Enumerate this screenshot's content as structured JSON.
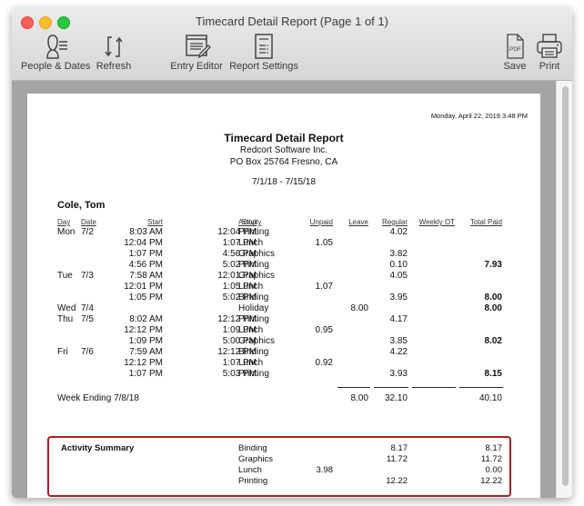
{
  "window": {
    "title": "Timecard Detail Report  (Page 1 of 1)"
  },
  "toolbar": {
    "people_dates": {
      "label": "People & Dates",
      "icon": "people-list-icon"
    },
    "refresh": {
      "label": "Refresh",
      "icon": "refresh-icon"
    },
    "entry_editor": {
      "label": "Entry Editor",
      "icon": "entry-editor-icon"
    },
    "report_settings": {
      "label": "Report Settings",
      "icon": "report-settings-icon"
    },
    "save": {
      "label": "Save",
      "icon": "pdf-icon",
      "icon_text": "PDF"
    },
    "print": {
      "label": "Print",
      "icon": "printer-icon"
    }
  },
  "report": {
    "timestamp": "Monday, April 22, 2019  3:48 PM",
    "title": "Timecard Detail Report",
    "company": "Redcort Software Inc.",
    "address": "PO Box 25764  Fresno, CA",
    "date_range": "7/1/18 - 7/15/18",
    "employee": "Cole, Tom",
    "columns": {
      "day": "Day",
      "date": "Date",
      "start": "Start",
      "stop": "Stop",
      "activity": "Activity",
      "unpaid": "Unpaid",
      "leave": "Leave",
      "regular": "Regular",
      "weekly_ot": "Weekly OT",
      "total_paid": "Total Paid"
    },
    "rows": [
      {
        "day": "Mon",
        "date": "7/2",
        "start": "8:03 AM",
        "stop": "12:04 PM",
        "activity": "Printing",
        "unpaid": "",
        "leave": "",
        "regular": "4.02",
        "weekly_ot": "",
        "total_paid": ""
      },
      {
        "day": "",
        "date": "",
        "start": "12:04 PM",
        "stop": "1:07 PM",
        "activity": "Lunch",
        "unpaid": "1.05",
        "leave": "",
        "regular": "",
        "weekly_ot": "",
        "total_paid": ""
      },
      {
        "day": "",
        "date": "",
        "start": "1:07 PM",
        "stop": "4:56 PM",
        "activity": "Graphics",
        "unpaid": "",
        "leave": "",
        "regular": "3.82",
        "weekly_ot": "",
        "total_paid": ""
      },
      {
        "day": "",
        "date": "",
        "start": "4:56 PM",
        "stop": "5:02 PM",
        "activity": "Printing",
        "unpaid": "",
        "leave": "",
        "regular": "0.10",
        "weekly_ot": "",
        "total_paid": "7.93"
      },
      {
        "day": "Tue",
        "date": "7/3",
        "start": "7:58 AM",
        "stop": "12:01 PM",
        "activity": "Graphics",
        "unpaid": "",
        "leave": "",
        "regular": "4.05",
        "weekly_ot": "",
        "total_paid": ""
      },
      {
        "day": "",
        "date": "",
        "start": "12:01 PM",
        "stop": "1:05 PM",
        "activity": "Lunch",
        "unpaid": "1.07",
        "leave": "",
        "regular": "",
        "weekly_ot": "",
        "total_paid": ""
      },
      {
        "day": "",
        "date": "",
        "start": "1:05 PM",
        "stop": "5:02 PM",
        "activity": "Binding",
        "unpaid": "",
        "leave": "",
        "regular": "3.95",
        "weekly_ot": "",
        "total_paid": "8.00"
      },
      {
        "day": "Wed",
        "date": "7/4",
        "start": "",
        "stop": "",
        "activity": "Holiday",
        "unpaid": "",
        "leave": "8.00",
        "regular": "",
        "weekly_ot": "",
        "total_paid": "8.00"
      },
      {
        "day": "Thu",
        "date": "7/5",
        "start": "8:02 AM",
        "stop": "12:12 PM",
        "activity": "Printing",
        "unpaid": "",
        "leave": "",
        "regular": "4.17",
        "weekly_ot": "",
        "total_paid": ""
      },
      {
        "day": "",
        "date": "",
        "start": "12:12 PM",
        "stop": "1:09 PM",
        "activity": "Lunch",
        "unpaid": "0.95",
        "leave": "",
        "regular": "",
        "weekly_ot": "",
        "total_paid": ""
      },
      {
        "day": "",
        "date": "",
        "start": "1:09 PM",
        "stop": "5:00 PM",
        "activity": "Graphics",
        "unpaid": "",
        "leave": "",
        "regular": "3.85",
        "weekly_ot": "",
        "total_paid": "8.02"
      },
      {
        "day": "Fri",
        "date": "7/6",
        "start": "7:59 AM",
        "stop": "12:12 PM",
        "activity": "Binding",
        "unpaid": "",
        "leave": "",
        "regular": "4.22",
        "weekly_ot": "",
        "total_paid": ""
      },
      {
        "day": "",
        "date": "",
        "start": "12:12 PM",
        "stop": "1:07 PM",
        "activity": "Lunch",
        "unpaid": "0.92",
        "leave": "",
        "regular": "",
        "weekly_ot": "",
        "total_paid": ""
      },
      {
        "day": "",
        "date": "",
        "start": "1:07 PM",
        "stop": "5:03 PM",
        "activity": "Printing",
        "unpaid": "",
        "leave": "",
        "regular": "3.93",
        "weekly_ot": "",
        "total_paid": "8.15"
      }
    ],
    "week_total": {
      "label": "Week Ending 7/8/18",
      "leave": "8.00",
      "regular": "32.10",
      "total_paid": "40.10"
    },
    "activity_summary": {
      "label": "Activity Summary",
      "highlight_color": "#b01d22",
      "rows": [
        {
          "activity": "Binding",
          "unpaid": "",
          "regular": "8.17",
          "total_paid": "8.17"
        },
        {
          "activity": "Graphics",
          "unpaid": "",
          "regular": "11.72",
          "total_paid": "11.72"
        },
        {
          "activity": "Lunch",
          "unpaid": "3.98",
          "regular": "",
          "total_paid": "0.00"
        },
        {
          "activity": "Printing",
          "unpaid": "",
          "regular": "12.22",
          "total_paid": "12.22"
        }
      ]
    }
  }
}
